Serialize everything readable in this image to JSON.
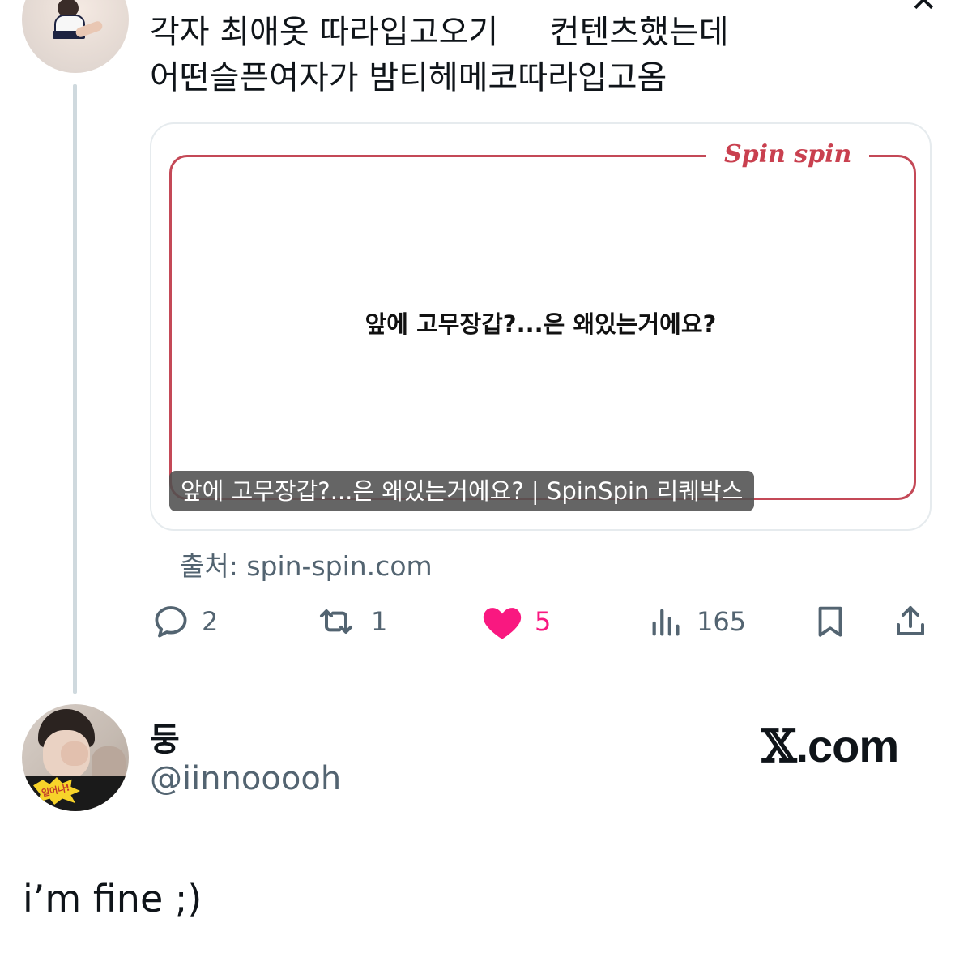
{
  "tweet1": {
    "text_line1": "각자 최애옷 따라입고오기     컨텐츠했는데",
    "text_line2": "어떤슬픈여자가 밤티헤메코따라입고옴",
    "card": {
      "brand": "Spin spin",
      "question": "앞에 고무장갑?...은 왜있는거에요?",
      "title": "앞에 고무장갑?...은 왜있는거에요? | SpinSpin 리퀘박스"
    },
    "source": "출처: spin-spin.com",
    "actions": {
      "replies": "2",
      "retweets": "1",
      "likes": "5",
      "views": "165"
    },
    "like_color": "#f91880"
  },
  "tweet2": {
    "display_name": "둥",
    "handle": "@iinnooooh",
    "avatar_sticker_text": "일어나!",
    "body": "i’m fine ;)"
  },
  "watermark": {
    "mark": "𝕏",
    "text": ".com"
  },
  "icons": [
    "reply-icon",
    "retweet-icon",
    "heart-icon",
    "views-icon",
    "bookmark-icon",
    "share-icon",
    "x-logo-icon"
  ]
}
